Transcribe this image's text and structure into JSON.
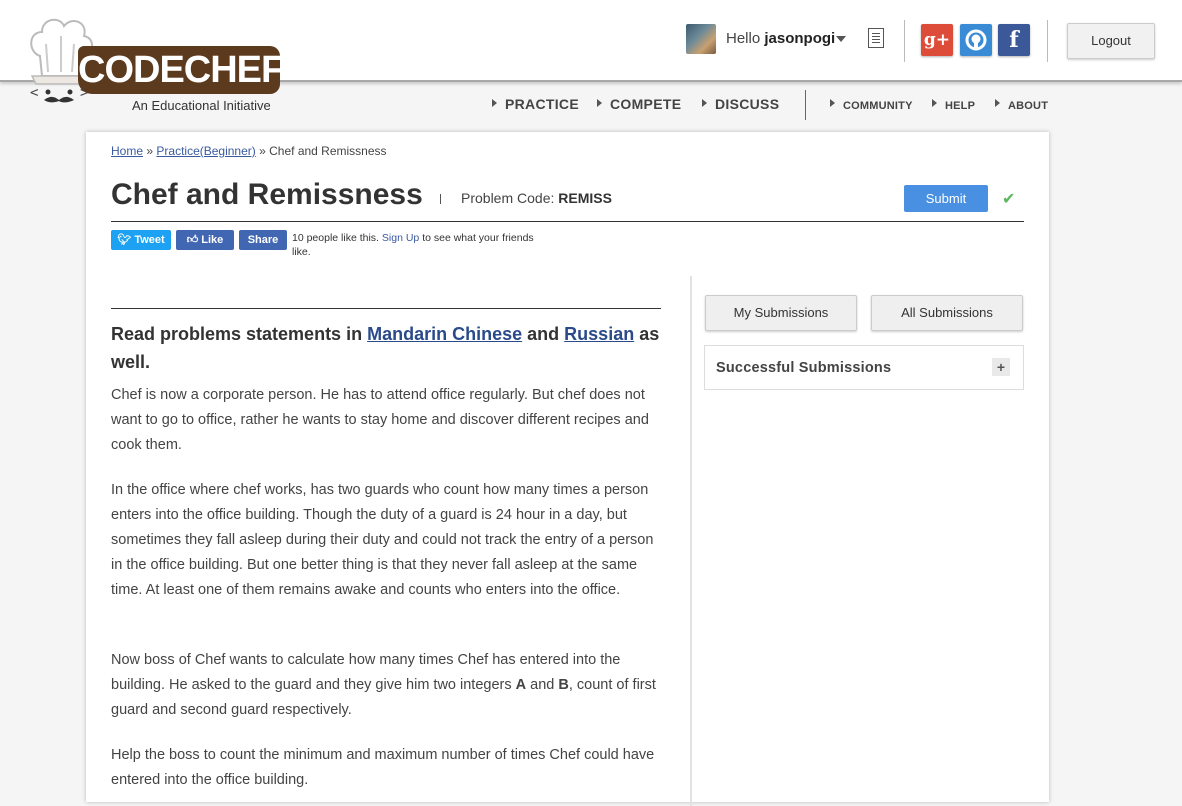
{
  "brand": {
    "logo_text": "CODECHEF",
    "tagline": "An Educational Initiative"
  },
  "user": {
    "greeting": "Hello",
    "username": "jasonpogi"
  },
  "header": {
    "logout_label": "Logout",
    "social": {
      "gplus": "g+",
      "github": "github",
      "facebook": "f"
    }
  },
  "nav": {
    "main": [
      "PRACTICE",
      "COMPETE",
      "DISCUSS"
    ],
    "sub": [
      "COMMUNITY",
      "HELP",
      "ABOUT"
    ]
  },
  "breadcrumb": {
    "home": "Home",
    "sep1": "»",
    "practice": "Practice(Beginner)",
    "sep2": "»",
    "current": "Chef and Remissness"
  },
  "problem": {
    "title": "Chef and Remissness",
    "code_label": "Problem Code:",
    "code": "REMISS",
    "submit_label": "Submit"
  },
  "social_bar": {
    "tweet": "Tweet",
    "like": "Like",
    "share": "Share",
    "likes_text": "10 people like this.",
    "signup": "Sign Up",
    "likes_suffix": "to see what your friends like."
  },
  "statement": {
    "read_prefix": "Read problems statements in",
    "lang1": "Mandarin Chinese",
    "and": "and",
    "lang2": "Russian",
    "read_suffix": "as well.",
    "p1": "Chef is now a corporate person. He has to attend office regularly. But chef does not want to go to office, rather he wants to stay home and discover different recipes and cook them.",
    "p2": "In the office where chef works, has two guards who count how many times a person enters into the office building. Though the duty of a guard is 24 hour in a day, but sometimes they fall asleep during their duty and could not track the entry of a person in the office building. But one better thing is that they never fall asleep at the same time. At least one of them remains awake and counts who enters into the office.",
    "p3_a": "Now boss of Chef wants to calculate how many times Chef has entered into the building. He asked to the guard and they give him two integers",
    "p3_A": "A",
    "p3_and": "and",
    "p3_B": "B",
    "p3_b": ", count of first guard and second guard respectively.",
    "p4": "Help the boss to count the minimum and maximum number of times Chef could have entered into the office building."
  },
  "sidebar": {
    "my_submissions": "My Submissions",
    "all_submissions": "All Submissions",
    "successful": "Successful Submissions",
    "expand": "+"
  }
}
